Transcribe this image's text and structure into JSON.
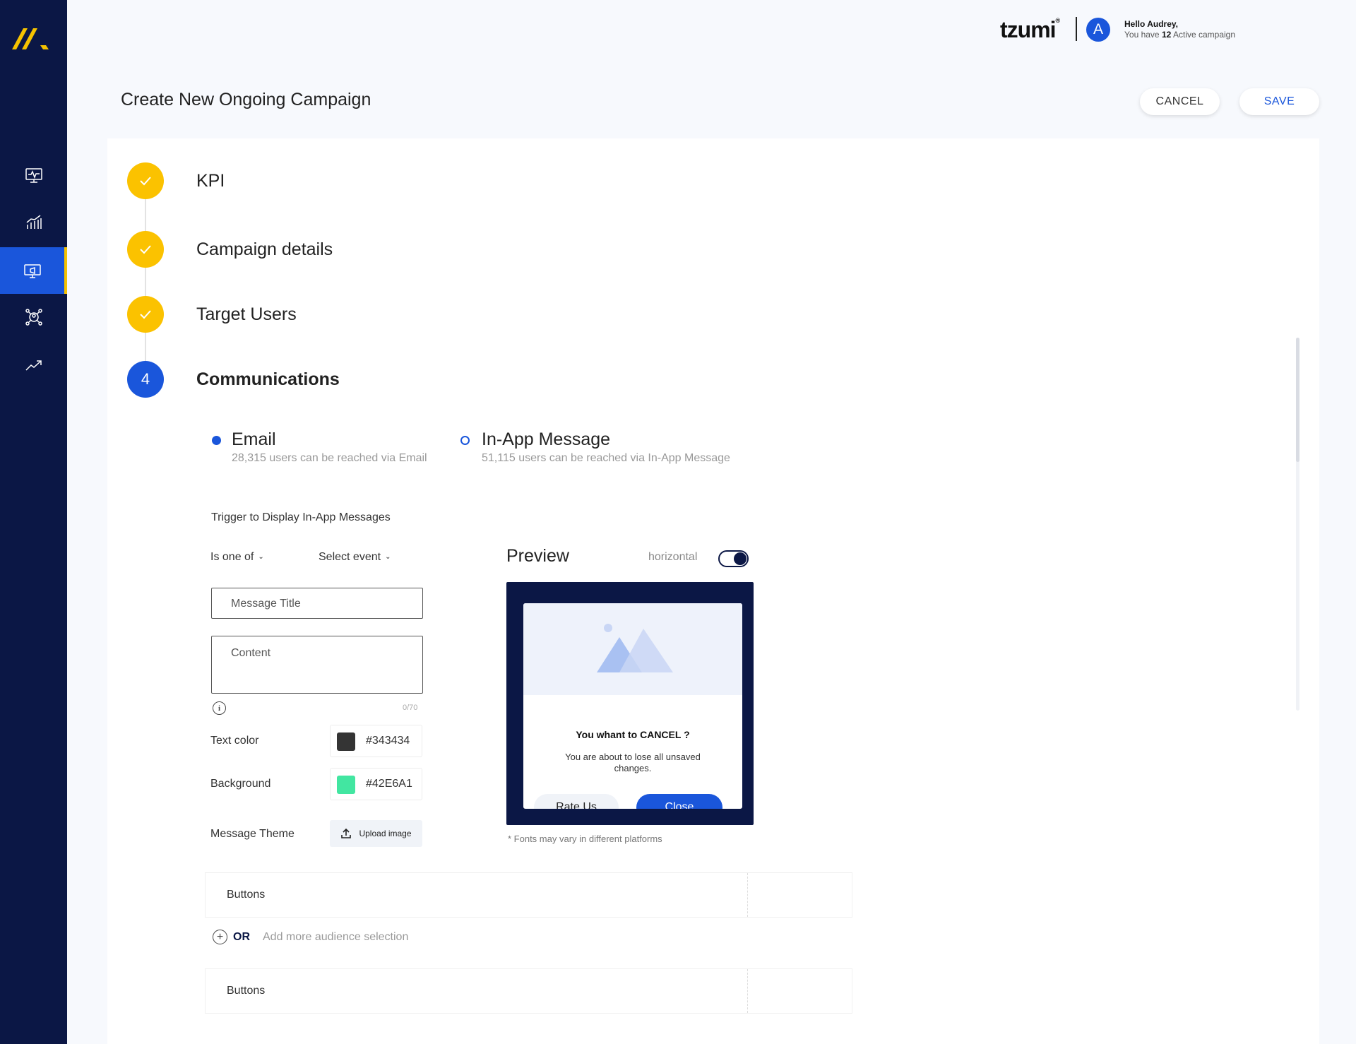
{
  "header": {
    "brand": "tzumi",
    "brand_reg": "®",
    "avatar_letter": "A",
    "greeting": "Hello Audrey,",
    "sub_prefix": "You have ",
    "active_count": "12",
    "sub_suffix": " Active campaign"
  },
  "sidebar": {
    "items": [
      {
        "icon": "monitor-pulse-icon"
      },
      {
        "icon": "bar-chart-icon"
      },
      {
        "icon": "campaign-screen-icon",
        "active": true
      },
      {
        "icon": "users-network-icon"
      },
      {
        "icon": "trend-up-icon"
      }
    ]
  },
  "page": {
    "title": "Create New Ongoing Campaign",
    "cancel_label": "CANCEL",
    "save_label": "SAVE"
  },
  "steps": [
    {
      "label": "KPI",
      "status": "done"
    },
    {
      "label": "Campaign details",
      "status": "done"
    },
    {
      "label": "Target Users",
      "status": "done"
    },
    {
      "label": "Communications",
      "status": "current",
      "number": "4"
    }
  ],
  "channels": [
    {
      "title": "Email",
      "subtitle": "28,315 users can be reached via Email",
      "selected": true
    },
    {
      "title": "In-App Message",
      "subtitle": "51,115 users can be reached via In-App Message",
      "selected": false
    }
  ],
  "form": {
    "trigger_label": "Trigger to Display In-App Messages",
    "condition": "Is one of",
    "event": "Select event",
    "message_title_placeholder": "Message Title",
    "content_placeholder": "Content",
    "info_glyph": "i",
    "counter": "0/70",
    "text_color_label": "Text color",
    "text_color_value": "#343434",
    "background_label": "Background",
    "background_value": "#42E6A1",
    "theme_label": "Message Theme",
    "upload_label": "Upload image"
  },
  "preview": {
    "title": "Preview",
    "toggle_label": "horizontal",
    "toggle_on": true,
    "modal_title": "You whant to CANCEL ?",
    "modal_text": "You are about to lose all unsaved changes.",
    "rate_label": "Rate Us",
    "close_label": "Close",
    "note": "* Fonts may vary in different platforms"
  },
  "button_rows": [
    {
      "label": "Buttons"
    },
    {
      "label": "Buttons"
    }
  ],
  "audience": {
    "add_glyph": "+",
    "or_label": "OR",
    "add_more_label": "Add more audience selection"
  },
  "colors": {
    "sidebar": "#0b1745",
    "accent": "#1a56db",
    "step_done": "#fbc200",
    "text_swatch": "#343434",
    "bg_swatch": "#42E6A1"
  }
}
